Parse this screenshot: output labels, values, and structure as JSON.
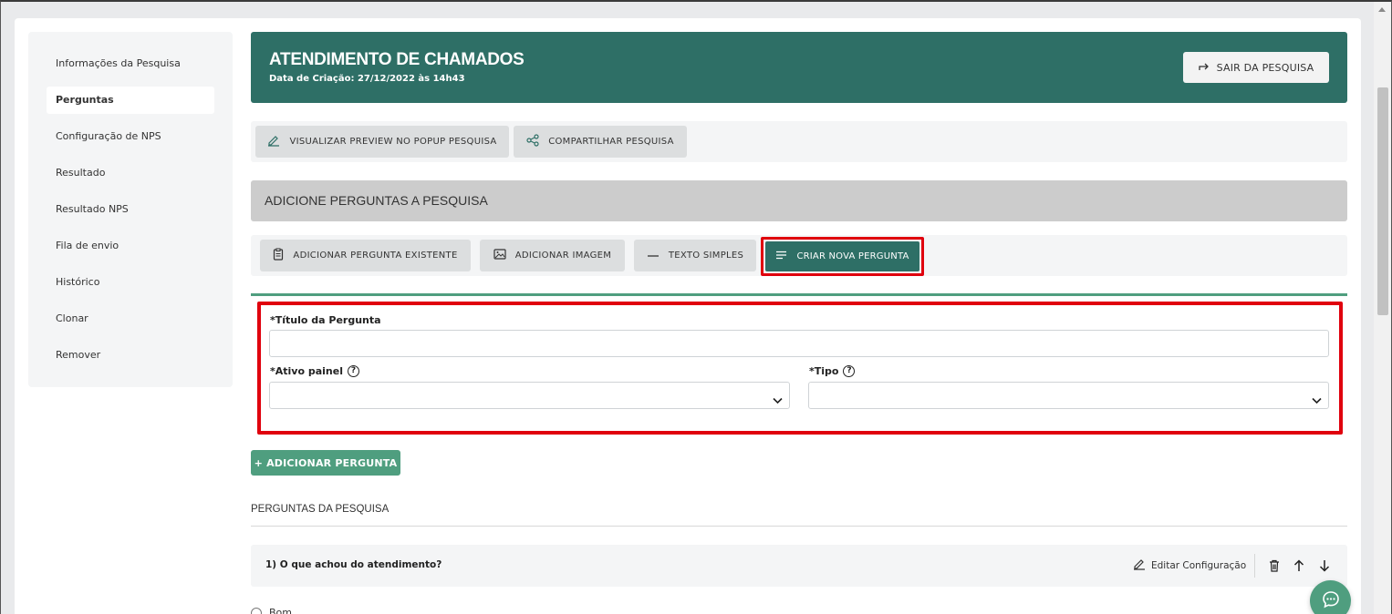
{
  "colors": {
    "brand": "#2e6f66",
    "accent_green": "#4f9e7f",
    "highlight_red": "#e0000d"
  },
  "sidebar": {
    "items": [
      {
        "label": "Informações da Pesquisa"
      },
      {
        "label": "Perguntas",
        "active": true
      },
      {
        "label": "Configuração de NPS"
      },
      {
        "label": "Resultado"
      },
      {
        "label": "Resultado NPS"
      },
      {
        "label": "Fila de envio"
      },
      {
        "label": "Histórico"
      },
      {
        "label": "Clonar"
      },
      {
        "label": "Remover"
      }
    ]
  },
  "header": {
    "title": "ATENDIMENTO DE CHAMADOS",
    "subtitle": "Data de Criação: 27/12/2022 às 14h43",
    "exit_label": "SAIR DA PESQUISA"
  },
  "actions": {
    "preview_label": "VISUALIZAR PREVIEW NO POPUP PESQUISA",
    "share_label": "COMPARTILHAR PESQUISA"
  },
  "section": {
    "title": "ADICIONE PERGUNTAS A PESQUISA"
  },
  "question_tools": {
    "existing_label": "ADICIONAR PERGUNTA EXISTENTE",
    "image_label": "ADICIONAR IMAGEM",
    "text_label": "TEXTO SIMPLES",
    "create_label": "CRIAR NOVA PERGUNTA"
  },
  "form": {
    "title_label": "*Título da Pergunta",
    "title_value": "",
    "active_label": "*Ativo painel",
    "active_value": "",
    "type_label": "*Tipo",
    "type_value": ""
  },
  "add_question_label": "+ ADICIONAR PERGUNTA",
  "questions_list": {
    "title": "PERGUNTAS DA PESQUISA",
    "items": [
      {
        "text": "1) O que achou do atendimento?",
        "edit_label": "Editar Configuração",
        "options": [
          "Bom"
        ]
      }
    ]
  },
  "icons": [
    "arrow-exit-icon",
    "pencil-icon",
    "share-icon",
    "clipboard-icon",
    "image-icon",
    "minus-icon",
    "lines-icon",
    "help-icon",
    "chevron-down-icon",
    "trash-icon",
    "arrow-up-icon",
    "arrow-down-icon",
    "chat-icon"
  ]
}
